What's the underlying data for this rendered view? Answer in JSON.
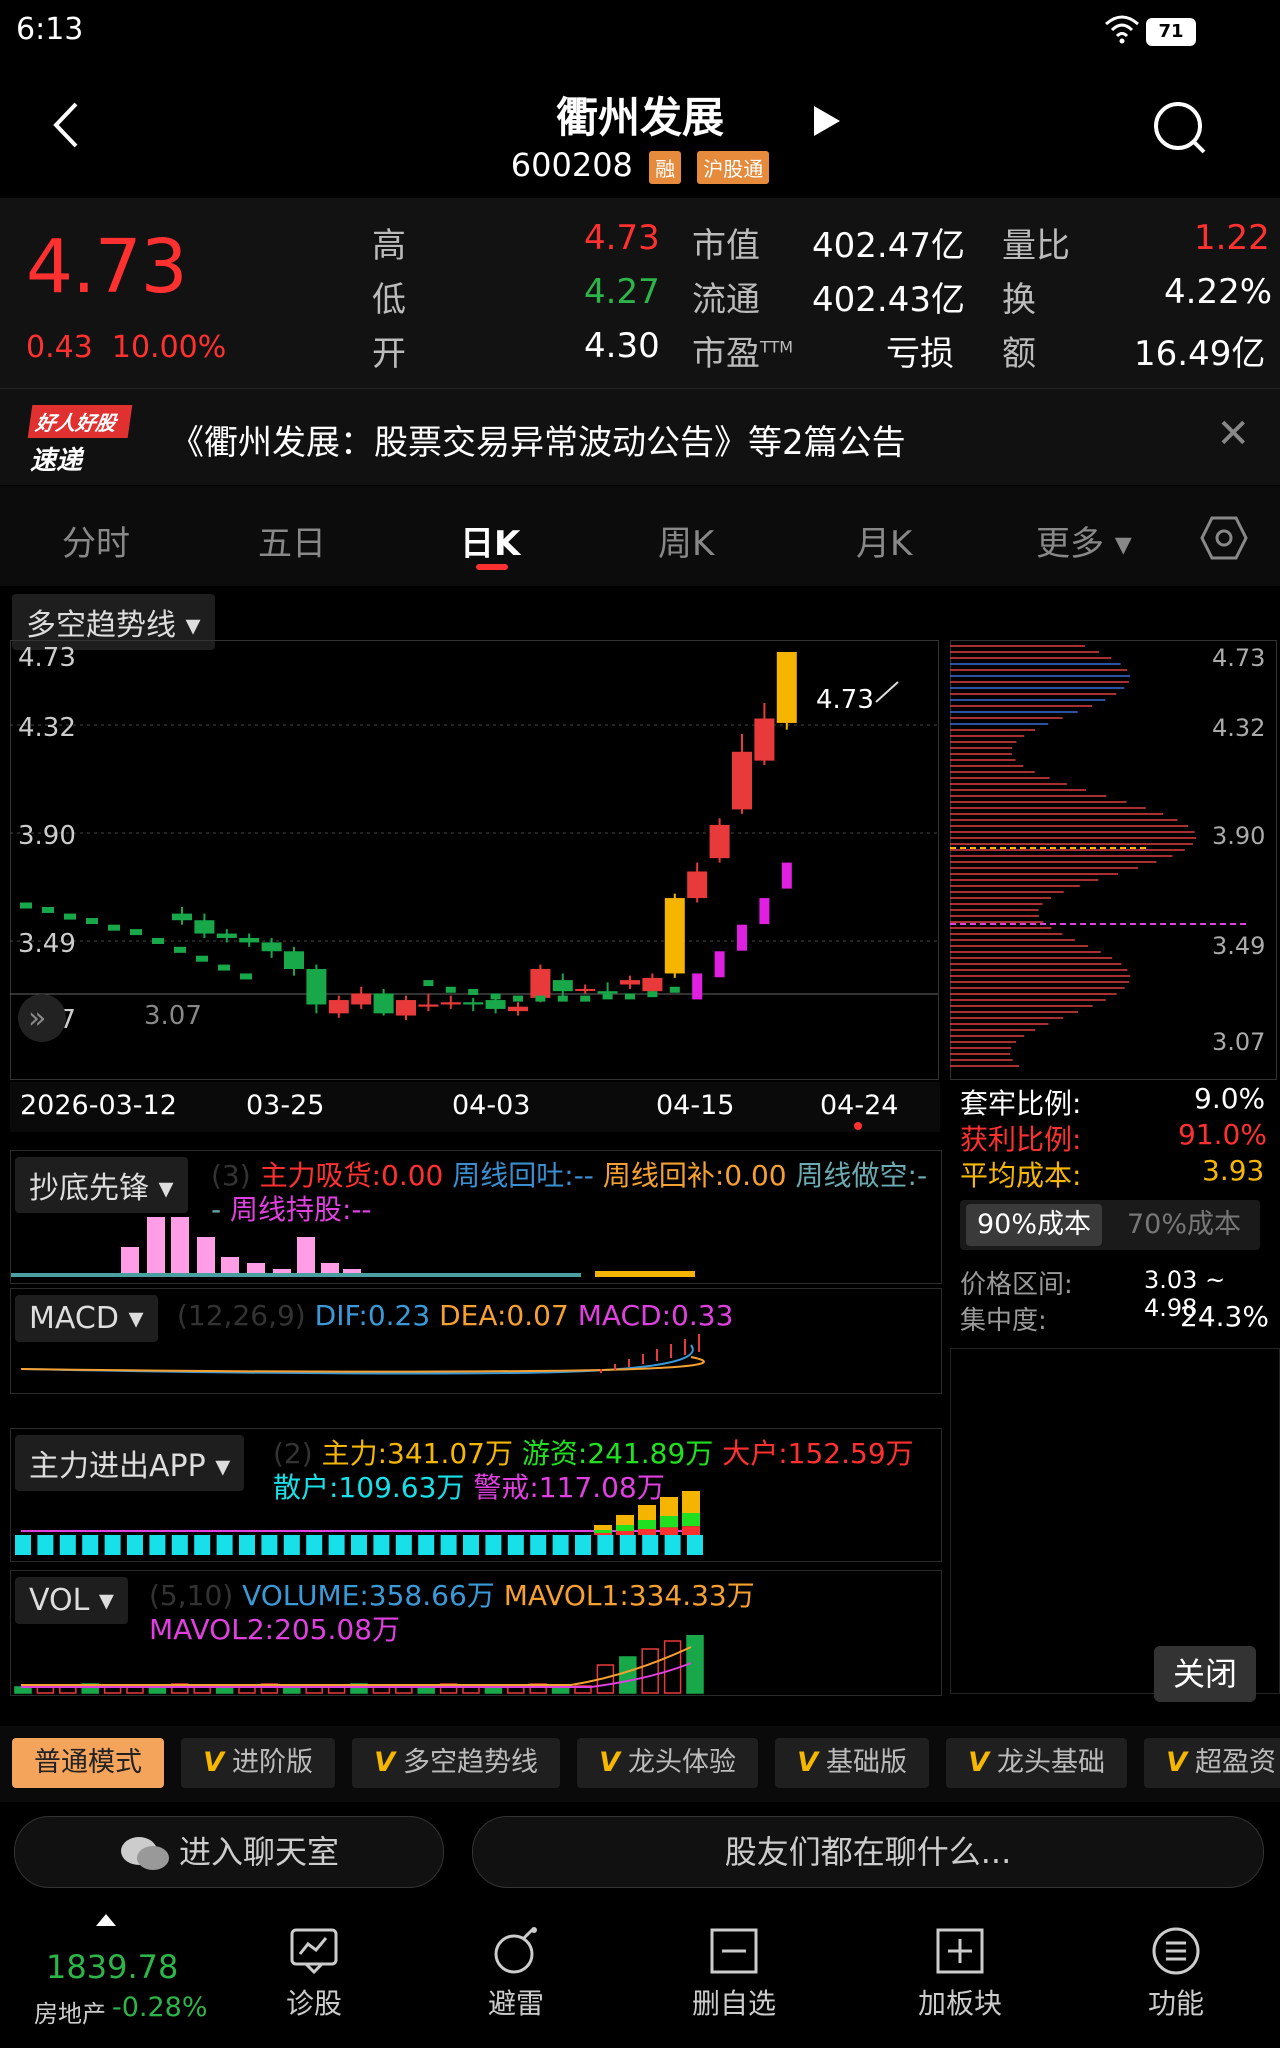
{
  "status": {
    "time": "6:13",
    "battery": "71"
  },
  "header": {
    "title": "衢州发展",
    "code": "600208",
    "tag_margin": "融",
    "tag_connect": "沪股通"
  },
  "quote": {
    "price": "4.73",
    "change": "0.43",
    "change_pct": "10.00%",
    "high_label": "高",
    "high": "4.73",
    "low_label": "低",
    "low": "4.27",
    "open_label": "开",
    "open": "4.30",
    "mcap_label": "市值",
    "mcap": "402.47亿",
    "float_label": "流通",
    "float": "402.43亿",
    "pe_label": "市盈",
    "pe_sup": "TTM",
    "pe": "亏损",
    "vr_label": "量比",
    "vr": "1.22",
    "turnover_label": "换",
    "turnover": "4.22%",
    "amount_label": "额",
    "amount": "16.49亿"
  },
  "news": {
    "logo_top": "好人好股",
    "logo_bottom": "速递",
    "text": "《衢州发展：股票交易异常波动公告》等2篇公告"
  },
  "tabs": [
    "分时",
    "五日",
    "日K",
    "周K",
    "月K",
    "更多"
  ],
  "kline": {
    "indicator": "多空趋势线",
    "y_labels": [
      "4.73",
      "4.32",
      "3.90",
      "3.49",
      "3.07"
    ],
    "x_labels": [
      "2026-03-12",
      "03-25",
      "04-03",
      "04-15",
      "04-24"
    ],
    "max_label": "4.73",
    "min_label": "3.07"
  },
  "chip": {
    "y_labels": [
      "4.73",
      "4.32",
      "3.90",
      "3.49",
      "3.07"
    ],
    "trap_label": "套牢比例:",
    "trap": "9.0%",
    "profit_label": "获利比例:",
    "profit": "91.0%",
    "avg_label": "平均成本:",
    "avg": "3.93",
    "tab90": "90%成本",
    "tab70": "70%成本",
    "range_label": "价格区间:",
    "range": "3.03 ~ 4.98",
    "conc_label": "集中度:",
    "conc": "24.3%",
    "close": "关闭"
  },
  "ind1": {
    "name": "抄底先锋",
    "param": "(3)",
    "main": "主力吸货:0.00",
    "back": "周线回吐:--",
    "fill": "周线回补:0.00",
    "do": "周线做空:--",
    "hold": "周线持股:--"
  },
  "ind2": {
    "name": "MACD",
    "param": "(12,26,9)",
    "dif": "DIF:0.23",
    "dea": "DEA:0.07",
    "macd": "MACD:0.33"
  },
  "ind3": {
    "name": "主力进出APP",
    "param": "(2)",
    "main": "主力:341.07万",
    "hot": "游资:241.89万",
    "big": "大户:152.59万",
    "small": "散户:109.63万",
    "warn": "警戒:117.08万"
  },
  "ind4": {
    "name": "VOL",
    "param": "(5,10)",
    "vol": "VOLUME:358.66万",
    "m1": "MAVOL1:334.33万",
    "m2": "MAVOL2:205.08万"
  },
  "modes": [
    "普通模式",
    "进阶版",
    "多空趋势线",
    "龙头体验",
    "基础版",
    "龙头基础",
    "超盈资"
  ],
  "chat": {
    "enter": "进入聊天室",
    "placeholder": "股友们都在聊什么..."
  },
  "nav": {
    "index_value": "1839.78",
    "index_name": "房地产",
    "index_change": "-0.28%",
    "items": [
      "诊股",
      "避雷",
      "删自选",
      "加板块",
      "功能"
    ]
  },
  "colors": {
    "up": "#ff3030",
    "down": "#2db54a",
    "accent": "#f5a45b"
  }
}
